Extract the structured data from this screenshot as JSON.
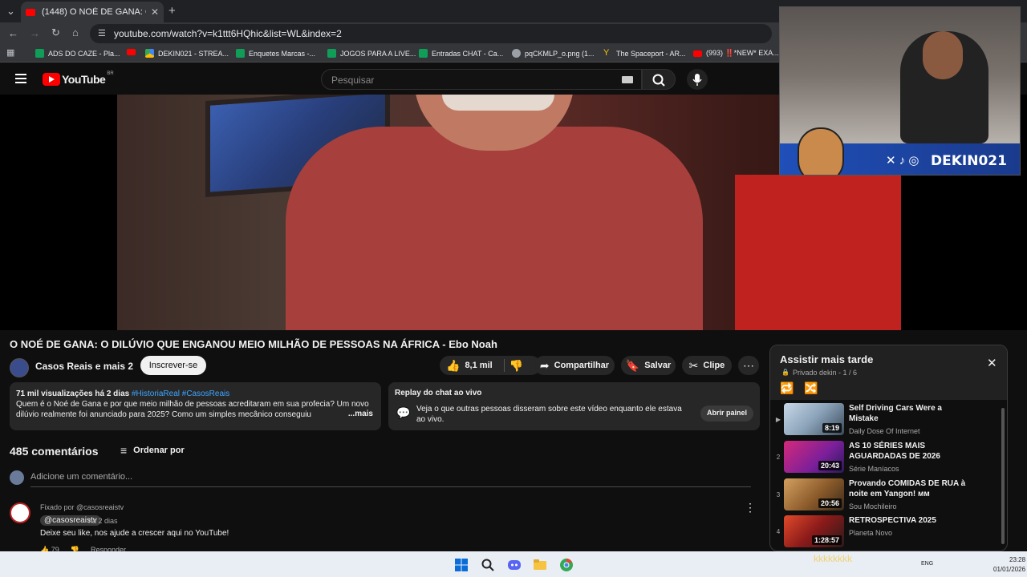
{
  "browser": {
    "tab_title": "(1448) O NOÉ DE GANA: O DILÚ",
    "url": "youtube.com/watch?v=k1ttt6HQhic&list=WL&index=2",
    "bookmarks": [
      "ADS DO CAZE - Pla...",
      "DEKIN021 - STREA...",
      "Enquetes Marcas -...",
      "JOGOS PARA A LIVE...",
      "Entradas CHAT - Ca...",
      "pqCKMLP_o.png (1...",
      "The Spaceport - AR...",
      "(993) ‼️*NEW* EXA..."
    ]
  },
  "youtube": {
    "logo_text": "YouTube",
    "country_code": "BR",
    "search_placeholder": "Pesquisar"
  },
  "webcam": {
    "channel_text": "DEKIN021"
  },
  "video": {
    "title": "O NOÉ DE GANA: O DILÚVIO QUE ENGANOU MEIO MILHÃO DE PESSOAS NA ÁFRICA - Ebo Noah",
    "channel": "Casos Reais e mais 2",
    "subscribe_label": "Inscrever-se",
    "likes": "8,1 mil",
    "share_label": "Compartilhar",
    "save_label": "Salvar",
    "clip_label": "Clipe"
  },
  "description": {
    "views_date": "71 mil visualizações  há 2 dias",
    "tags": "#HistoriaReal #CasosReais",
    "text": "Quem é o Noé de Gana e por que meio milhão de pessoas acreditaram em sua profecia? Um novo dilúvio realmente foi anunciado para 2025? Como um simples mecânico conseguiu",
    "more": "...mais"
  },
  "replay": {
    "title": "Replay do chat ao vivo",
    "text": "Veja o que outras pessoas disseram sobre este vídeo enquanto ele estava ao vivo.",
    "button": "Abrir painel"
  },
  "comments": {
    "count": "485 comentários",
    "sort_label": "Ordenar por",
    "add_placeholder": "Adicione um comentário...",
    "pinned": {
      "pinned_by": "Fixado por @casosreaistv",
      "handle": "@casosreaistv",
      "date": "há 2 dias",
      "text": "Deixe seu like, nos ajude a crescer aqui no YouTube!",
      "likes": "79",
      "reply": "Responder"
    }
  },
  "playlist": {
    "title": "Assistir mais tarde",
    "subtitle": "Privado  dekin  - 1 / 6",
    "items": [
      {
        "index": "▶",
        "title": "Self Driving Cars Were a Mistake",
        "channel": "Daily Dose Of Internet",
        "duration": "8:19"
      },
      {
        "index": "2",
        "title": "AS 10 SÉRIES MAIS AGUARDADAS DE 2026",
        "channel": "Série Maníacos",
        "duration": "20:43"
      },
      {
        "index": "3",
        "title": "Provando COMIDAS DE RUA à noite em Yangon! ᴍᴍ",
        "channel": "Sou Mochileiro",
        "duration": "20:56"
      },
      {
        "index": "4",
        "title": "RETROSPECTIVA 2025",
        "channel": "Planeta Novo",
        "duration": "1:28:57"
      }
    ]
  },
  "taskbar": {
    "lang": "ENG",
    "time": "23:28",
    "date": "01/01/2026",
    "overlay_text": "kkkkkkkk"
  },
  "colors": {
    "bg": "#0f0f0f",
    "accent_red": "#ff0000",
    "link_blue": "#3ea6ff"
  }
}
